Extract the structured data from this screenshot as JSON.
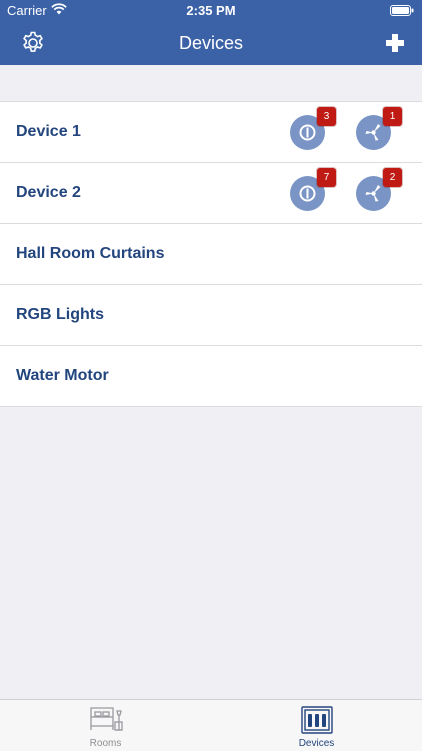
{
  "status_bar": {
    "carrier": "Carrier",
    "time": "2:35 PM"
  },
  "nav": {
    "title": "Devices"
  },
  "devices": [
    {
      "name": "Device 1",
      "badge_power": "3",
      "badge_fan": "1"
    },
    {
      "name": "Device 2",
      "badge_power": "7",
      "badge_fan": "2"
    },
    {
      "name": "Hall Room Curtains"
    },
    {
      "name": "RGB Lights"
    },
    {
      "name": "Water Motor"
    }
  ],
  "tabs": [
    {
      "label": "Rooms",
      "icon": "bed-icon",
      "selected": false
    },
    {
      "label": "Devices",
      "icon": "switchboard-icon",
      "selected": true
    }
  ],
  "colors": {
    "nav": "#3b62a6",
    "text": "#23457e",
    "badge": "#bf1a14",
    "icon_circle": "#7a95c5"
  }
}
